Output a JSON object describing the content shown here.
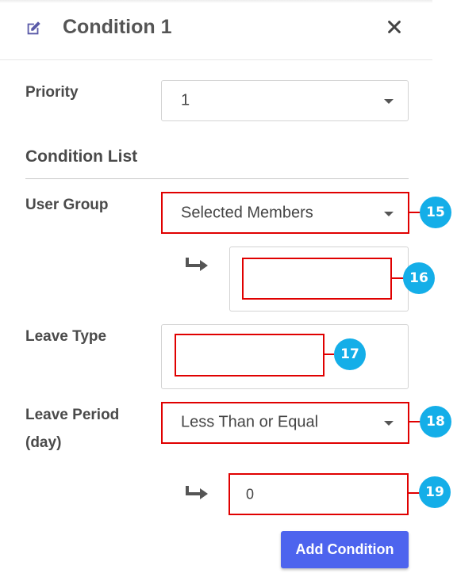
{
  "header": {
    "title": "Condition 1",
    "edit_icon": "edit-icon",
    "close_icon": "close-icon"
  },
  "priority": {
    "label": "Priority",
    "value": "1"
  },
  "condition_list": {
    "title": "Condition List"
  },
  "user_group": {
    "label": "User Group",
    "value": "Selected Members",
    "members_value": ""
  },
  "leave_type": {
    "label": "Leave Type",
    "value": ""
  },
  "leave_period": {
    "label_line1": "Leave Period",
    "label_line2": "(day)",
    "operator": "Less Than or Equal",
    "value": "0"
  },
  "annotations": [
    "15",
    "16",
    "17",
    "18",
    "19"
  ],
  "buttons": {
    "add_condition": "Add Condition"
  },
  "colors": {
    "accent": "#4d64ee",
    "highlight": "#e00000",
    "badge": "#14aee8"
  }
}
